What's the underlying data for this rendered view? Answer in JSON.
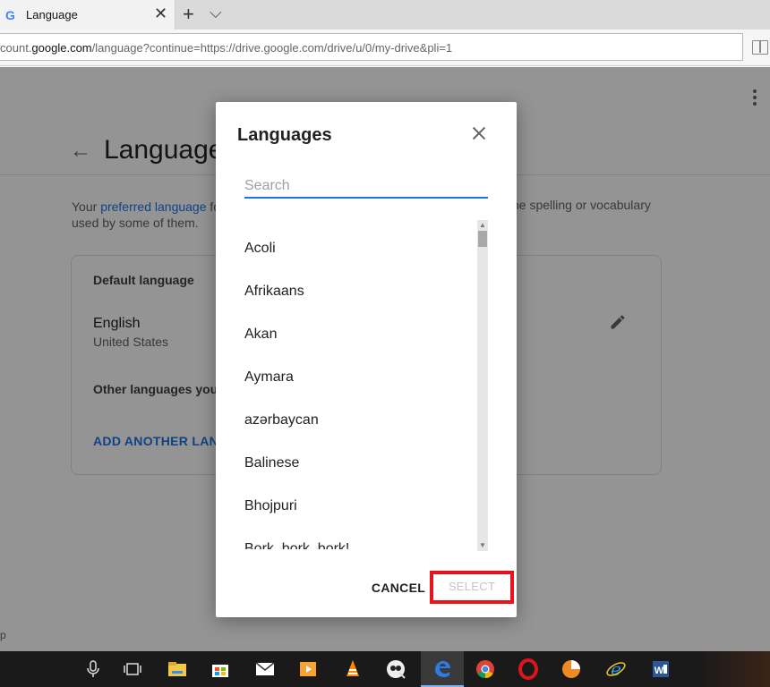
{
  "browser": {
    "tab_title": "Language",
    "tab_favicon_letter": "G",
    "close_tab_glyph": "✕",
    "new_tab_glyph": "+",
    "tab_menu_glyph": "⌵",
    "url_prefix": "count.",
    "url_domain": "google.com",
    "url_path": "/language?continue=https://drive.google.com/drive/u/0/my-drive&pli=1"
  },
  "page": {
    "back_glyph": "←",
    "title": "Language",
    "desc_before_link": "Your ",
    "desc_link": "preferred language",
    "desc_after_link": " fo",
    "desc_right": "he spelling or vocabulary",
    "desc_line2": "used by some of them.",
    "card": {
      "default_heading": "Default language",
      "default_language": "English",
      "default_region": "United States",
      "other_heading": "Other languages you u",
      "add_another": "ADD ANOTHER LANGU"
    },
    "bottom_letter": "p"
  },
  "dialog": {
    "title": "Languages",
    "search_placeholder": "Search",
    "languages": [
      "Acoli",
      "Afrikaans",
      "Akan",
      "Aymara",
      "azərbaycan",
      "Balinese",
      "Bhojpuri",
      "Bork, bork, bork!"
    ],
    "cancel_label": "CANCEL",
    "select_label": "SELECT",
    "highlight_color": "#e8141c",
    "accent_color": "#1a73e8"
  },
  "taskbar": {
    "icons": [
      "microphone-icon",
      "task-view-icon",
      "file-explorer-icon",
      "store-icon",
      "mail-icon",
      "media-player-icon",
      "vlc-icon",
      "app-icon",
      "edge-icon",
      "chrome-icon",
      "opera-icon",
      "pie-app-icon",
      "internet-explorer-icon",
      "word-icon"
    ],
    "active_icon": "edge-icon"
  }
}
